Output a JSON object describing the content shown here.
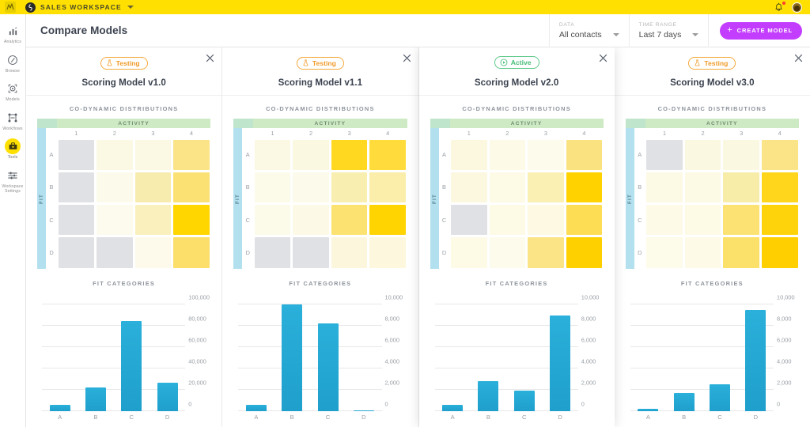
{
  "topbar": {
    "workspace_name": "SALES WORKSPACE",
    "logo_icon": "app-logo-icon",
    "workspace_icon": "workspace-globe-icon",
    "caret_icon": "chevron-down-icon",
    "bell_icon": "notification-bell-icon",
    "avatar_icon": "user-avatar",
    "bar_color": "#ffe000"
  },
  "sidebar": {
    "items": [
      {
        "label": "Analytics",
        "icon": "bar-chart-icon",
        "active": false
      },
      {
        "label": "Browse",
        "icon": "compass-icon",
        "active": false
      },
      {
        "label": "Models",
        "icon": "target-model-icon",
        "active": false
      },
      {
        "label": "Workflows",
        "icon": "workflow-nodes-icon",
        "active": false
      },
      {
        "label": "Tools",
        "icon": "toolbox-icon",
        "active": true
      },
      {
        "label": "Workspace Settings",
        "icon": "sliders-icon",
        "active": false
      }
    ],
    "active_highlight": "#ffe000"
  },
  "header": {
    "title": "Compare Models",
    "controls": [
      {
        "label": "DATA",
        "value": "All contacts",
        "caret_icon": "chevron-down-icon"
      },
      {
        "label": "TIME RANGE",
        "value": "Last 7 days",
        "caret_icon": "chevron-down-icon"
      }
    ],
    "cta": {
      "label": "CREATE MODEL",
      "plus": "+",
      "color": "#c33dff"
    }
  },
  "cards": [
    {
      "status": {
        "label": "Testing",
        "type": "testing",
        "icon": "flask-icon",
        "color": "#f09a28"
      },
      "title": "Scoring Model v1.0",
      "close_icon": "close-icon",
      "heatmap": {
        "title": "CO-DYNAMIC DISTRIBUTIONS",
        "x_axis_label": "ACTIVITY",
        "y_axis_label": "FIT",
        "columns": [
          "1",
          "2",
          "3",
          "4"
        ],
        "rows": [
          "A",
          "B",
          "C",
          "D"
        ],
        "cells": [
          [
            "#e0e1e5",
            "#fbf8e4",
            "#fbf8e3",
            "#fae487"
          ],
          [
            "#e0e1e5",
            "#fcfaeb",
            "#f7ecad",
            "#fbe173"
          ],
          [
            "#e0e1e5",
            "#fcfbee",
            "#faf0bd",
            "#ffd600"
          ],
          [
            "#e0e1e5",
            "#e0e1e5",
            "#fdfaeb",
            "#fbdf6a"
          ]
        ]
      },
      "chart_data": {
        "type": "bar",
        "title": "FIT CATEGORIES",
        "categories": [
          "A",
          "B",
          "C",
          "D"
        ],
        "values": [
          6000,
          22500,
          84500,
          27000
        ],
        "ticks": [
          "0",
          "20,000",
          "40,000",
          "60,000",
          "80,000",
          "100,000"
        ],
        "tick_values": [
          0,
          20000,
          40000,
          60000,
          80000,
          100000
        ],
        "ylim": [
          0,
          100000
        ],
        "xlabel": "",
        "ylabel": "",
        "grid": true,
        "bar_color": "#2ab0da"
      }
    },
    {
      "status": {
        "label": "Testing",
        "type": "testing",
        "icon": "flask-icon",
        "color": "#f09a28"
      },
      "title": "Scoring Model v1.1",
      "close_icon": "close-icon",
      "heatmap": {
        "title": "CO-DYNAMIC DISTRIBUTIONS",
        "x_axis_label": "ACTIVITY",
        "y_axis_label": "FIT",
        "columns": [
          "1",
          "2",
          "3",
          "4"
        ],
        "rows": [
          "A",
          "B",
          "C",
          "D"
        ],
        "cells": [
          [
            "#fbf8e3",
            "#fbf8e1",
            "#ffd81f",
            "#ffdc3c"
          ],
          [
            "#fcfae9",
            "#fcfaea",
            "#f8eeb0",
            "#faeeaa"
          ],
          [
            "#fcfae8",
            "#fcfae7",
            "#fbe271",
            "#ffd400"
          ],
          [
            "#e0e1e5",
            "#e0e1e5",
            "#fcf7dc",
            "#fdf8dd"
          ]
        ]
      },
      "chart_data": {
        "type": "bar",
        "title": "FIT CATEGORIES",
        "categories": [
          "A",
          "B",
          "C",
          "D"
        ],
        "values": [
          620,
          10000,
          8200,
          60
        ],
        "ticks": [
          "0",
          "2,000",
          "4,000",
          "6,000",
          "8,000",
          "10,000"
        ],
        "tick_values": [
          0,
          2000,
          4000,
          6000,
          8000,
          10000
        ],
        "ylim": [
          0,
          10000
        ],
        "xlabel": "",
        "ylabel": "",
        "grid": true,
        "bar_color": "#2ab0da"
      }
    },
    {
      "status": {
        "label": "Active",
        "type": "active",
        "icon": "play-circle-icon",
        "color": "#47bd77"
      },
      "title": "Scoring Model v2.0",
      "close_icon": "close-icon",
      "raised": true,
      "heatmap": {
        "title": "CO-DYNAMIC DISTRIBUTIONS",
        "x_axis_label": "ACTIVITY",
        "y_axis_label": "FIT",
        "columns": [
          "1",
          "2",
          "3",
          "4"
        ],
        "rows": [
          "A",
          "B",
          "C",
          "D"
        ],
        "cells": [
          [
            "#fcf8e0",
            "#fdfae7",
            "#fdfbec",
            "#fbe281"
          ],
          [
            "#fcf8e0",
            "#fdfae6",
            "#faf0b4",
            "#ffd200"
          ],
          [
            "#e0e1e5",
            "#fdfae6",
            "#fdf9e2",
            "#fcdd54"
          ],
          [
            "#fdfae6",
            "#fdfbeb",
            "#fbe485",
            "#ffd000"
          ]
        ]
      },
      "chart_data": {
        "type": "bar",
        "title": "FIT CATEGORIES",
        "categories": [
          "A",
          "B",
          "C",
          "D"
        ],
        "values": [
          620,
          2800,
          1900,
          9000
        ],
        "ticks": [
          "0",
          "2,000",
          "4,000",
          "6,000",
          "8,000",
          "10,000"
        ],
        "tick_values": [
          0,
          2000,
          4000,
          6000,
          8000,
          10000
        ],
        "ylim": [
          0,
          10000
        ],
        "xlabel": "",
        "ylabel": "",
        "grid": true,
        "bar_color": "#2ab0da"
      }
    },
    {
      "status": {
        "label": "Testing",
        "type": "testing",
        "icon": "flask-icon",
        "color": "#f09a28"
      },
      "title": "Scoring Model v3.0",
      "close_icon": "close-icon",
      "heatmap": {
        "title": "CO-DYNAMIC DISTRIBUTIONS",
        "x_axis_label": "ACTIVITY",
        "y_axis_label": "FIT",
        "columns": [
          "1",
          "2",
          "3",
          "4"
        ],
        "rows": [
          "A",
          "B",
          "C",
          "D"
        ],
        "cells": [
          [
            "#e0e1e5",
            "#fbf8e2",
            "#fbf8e2",
            "#fbe388"
          ],
          [
            "#fcf9e5",
            "#fcf9e4",
            "#f7eca8",
            "#ffd61c"
          ],
          [
            "#fdfae7",
            "#fdfae6",
            "#fbe273",
            "#ffd30c"
          ],
          [
            "#fdfbe9",
            "#fdfbe8",
            "#fbe069",
            "#ffcf00"
          ]
        ]
      },
      "chart_data": {
        "type": "bar",
        "title": "FIT CATEGORIES",
        "categories": [
          "A",
          "B",
          "C",
          "D"
        ],
        "values": [
          220,
          1700,
          2500,
          9500
        ],
        "ticks": [
          "0",
          "2,000",
          "4,000",
          "6,000",
          "8,000",
          "10,000"
        ],
        "tick_values": [
          0,
          2000,
          4000,
          6000,
          8000,
          10000
        ],
        "ylim": [
          0,
          10000
        ],
        "xlabel": "",
        "ylabel": "",
        "grid": true,
        "bar_color": "#2ab0da"
      }
    }
  ]
}
